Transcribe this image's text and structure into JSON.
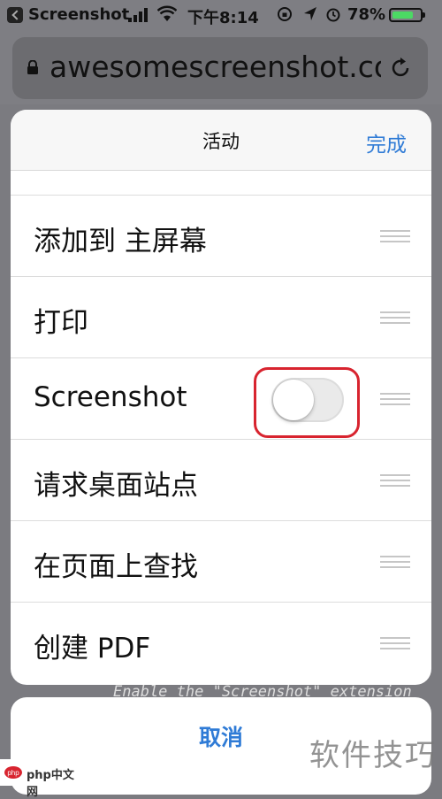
{
  "status_bar": {
    "back_app": "Screenshot",
    "time": "下午8:14",
    "battery_pct": "78%",
    "battery_level": 0.78,
    "icons": [
      "back-icon",
      "signal-icon",
      "wifi-icon",
      "rotation-lock-icon",
      "location-icon",
      "alarm-icon",
      "battery-icon"
    ]
  },
  "url_bar": {
    "url": "awesomescreenshot.com",
    "icons": [
      "lock-icon",
      "reload-icon"
    ]
  },
  "sheet": {
    "title": "活动",
    "done_label": "完成",
    "items": [
      {
        "label": "添加到 主屏幕"
      },
      {
        "label": "打印"
      },
      {
        "label": "Screenshot",
        "toggle": false
      },
      {
        "label": "请求桌面站点"
      },
      {
        "label": "在页面上查找"
      },
      {
        "label": "创建 PDF"
      }
    ]
  },
  "background_hint": "Enable the \"Screenshot\" extension",
  "cancel_label": "取消",
  "watermarks": {
    "left": "php中文网",
    "right": "软件技巧"
  },
  "colors": {
    "accent": "#2f7bd6",
    "callout": "#d8242f",
    "battery": "#4cd964"
  }
}
